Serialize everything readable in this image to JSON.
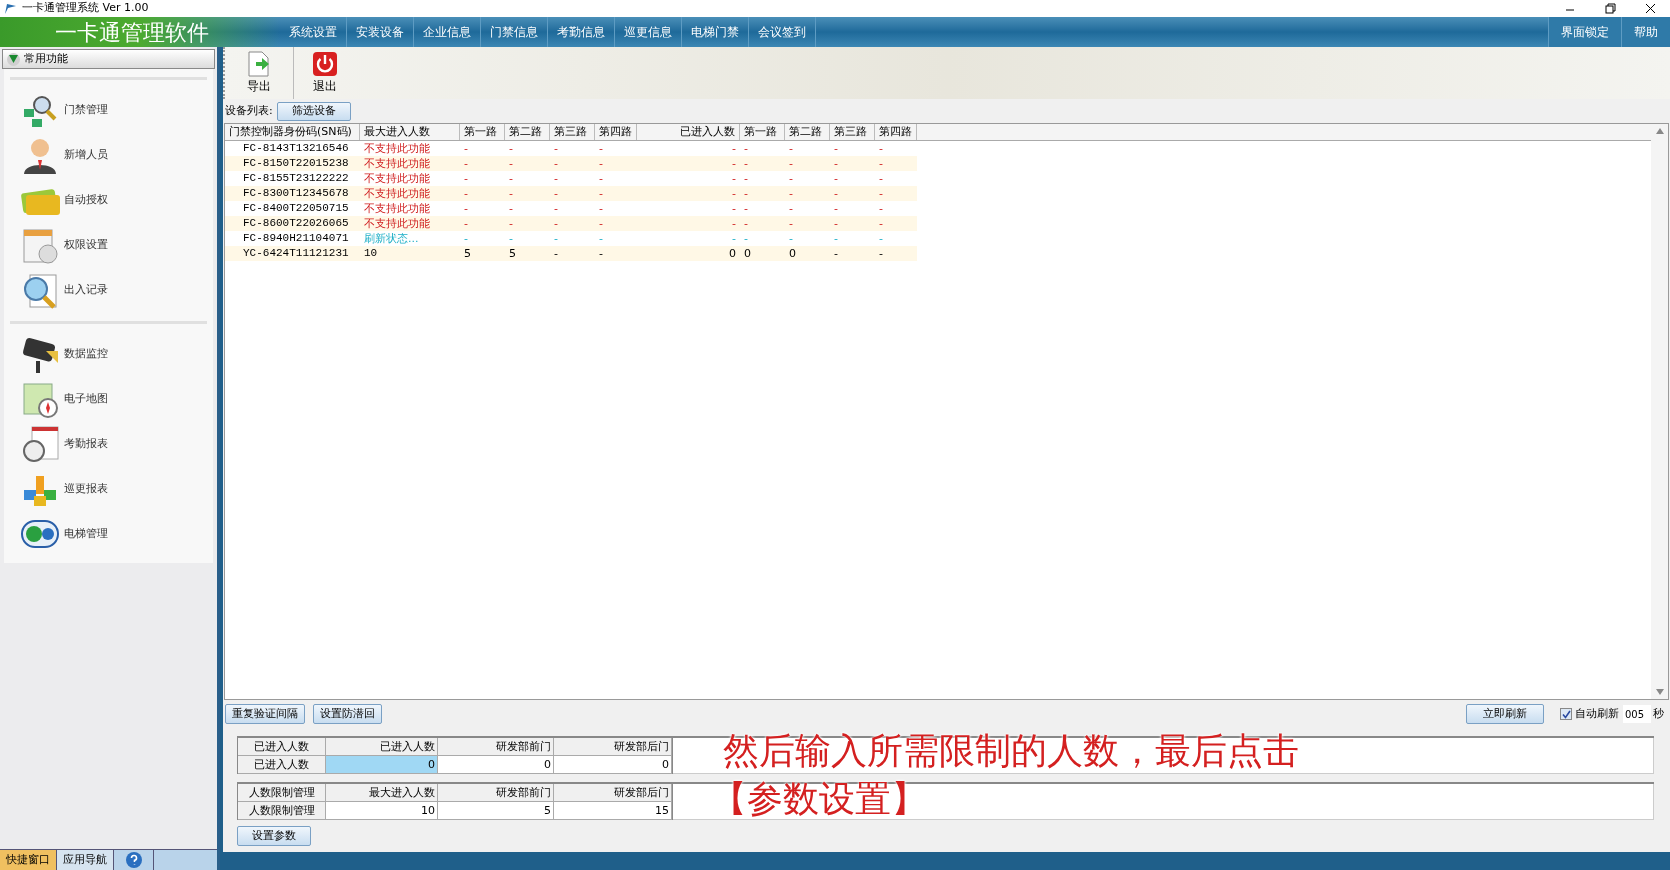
{
  "window": {
    "title": "一卡通管理系统  Ver 1.00"
  },
  "app_title": "一卡通管理软件",
  "menu": [
    "系统设置",
    "安装设备",
    "企业信息",
    "门禁信息",
    "考勤信息",
    "巡更信息",
    "电梯门禁",
    "会议签到"
  ],
  "menu_right": [
    "界面锁定",
    "帮助"
  ],
  "sidebar": {
    "header": "常用功能",
    "groups": [
      [
        "门禁管理",
        "新增人员",
        "自动授权",
        "权限设置",
        "出入记录"
      ],
      [
        "数据监控",
        "电子地图",
        "考勤报表",
        "巡更报表",
        "电梯管理"
      ]
    ],
    "tabs": [
      {
        "label": "快捷窗口",
        "selected": true
      },
      {
        "label": "应用导航",
        "selected": false
      }
    ]
  },
  "toolbar": [
    {
      "label": "导出",
      "kind": "export"
    },
    {
      "label": "退出",
      "kind": "exit"
    }
  ],
  "device_list": {
    "label": "设备列表:",
    "filter_button": "筛选设备"
  },
  "table": {
    "columns": [
      "门禁控制器身份码(SN码)",
      "最大进入人数",
      "第一路",
      "第二路",
      "第三路",
      "第四路",
      "已进入人数",
      "第一路",
      "第二路",
      "第三路",
      "第四路"
    ],
    "rows": [
      {
        "kind": "unsupported",
        "cells": [
          "FC-8143T13216546",
          "不支持此功能",
          "-",
          "-",
          "-",
          "-",
          "-",
          "-",
          "-",
          "-",
          "-"
        ]
      },
      {
        "kind": "unsupported",
        "cells": [
          "FC-8150T22015238",
          "不支持此功能",
          "-",
          "-",
          "-",
          "-",
          "-",
          "-",
          "-",
          "-",
          "-"
        ]
      },
      {
        "kind": "unsupported",
        "cells": [
          "FC-8155T23122222",
          "不支持此功能",
          "-",
          "-",
          "-",
          "-",
          "-",
          "-",
          "-",
          "-",
          "-"
        ]
      },
      {
        "kind": "unsupported",
        "cells": [
          "FC-8300T12345678",
          "不支持此功能",
          "-",
          "-",
          "-",
          "-",
          "-",
          "-",
          "-",
          "-",
          "-"
        ]
      },
      {
        "kind": "unsupported",
        "cells": [
          "FC-8400T22050715",
          "不支持此功能",
          "-",
          "-",
          "-",
          "-",
          "-",
          "-",
          "-",
          "-",
          "-"
        ]
      },
      {
        "kind": "unsupported",
        "cells": [
          "FC-8600T22026065",
          "不支持此功能",
          "-",
          "-",
          "-",
          "-",
          "-",
          "-",
          "-",
          "-",
          "-"
        ]
      },
      {
        "kind": "refreshing",
        "cells": [
          "FC-8940H21104071",
          "刷新状态...",
          "-",
          "-",
          "-",
          "-",
          "-",
          "-",
          "-",
          "-",
          "-"
        ]
      },
      {
        "kind": "normal",
        "cells": [
          "YC-6424T11121231",
          "10",
          "5",
          "5",
          "-",
          "-",
          "0",
          "0",
          "0",
          "-",
          "-"
        ]
      }
    ]
  },
  "buttons": [
    "重复验证间隔",
    "设置防潜回"
  ],
  "refresh_button": "立即刷新",
  "auto_refresh": {
    "label": "自动刷新",
    "checked": true,
    "interval": "005",
    "unit": "秒"
  },
  "entered_grid": {
    "columns": [
      "已进入人数",
      "已进入人数",
      "研发部前门",
      "研发部后门"
    ],
    "row": [
      "已进入人数",
      "0",
      "0",
      "0"
    ]
  },
  "limit_grid": {
    "columns": [
      "人数限制管理",
      "最大进入人数",
      "研发部前门",
      "研发部后门"
    ],
    "row": [
      "人数限制管理",
      "10",
      "5",
      "15"
    ]
  },
  "set_button": "设置参数",
  "caption": [
    "然后输入所需限制的人数，最后点击",
    "【参数设置】"
  ]
}
